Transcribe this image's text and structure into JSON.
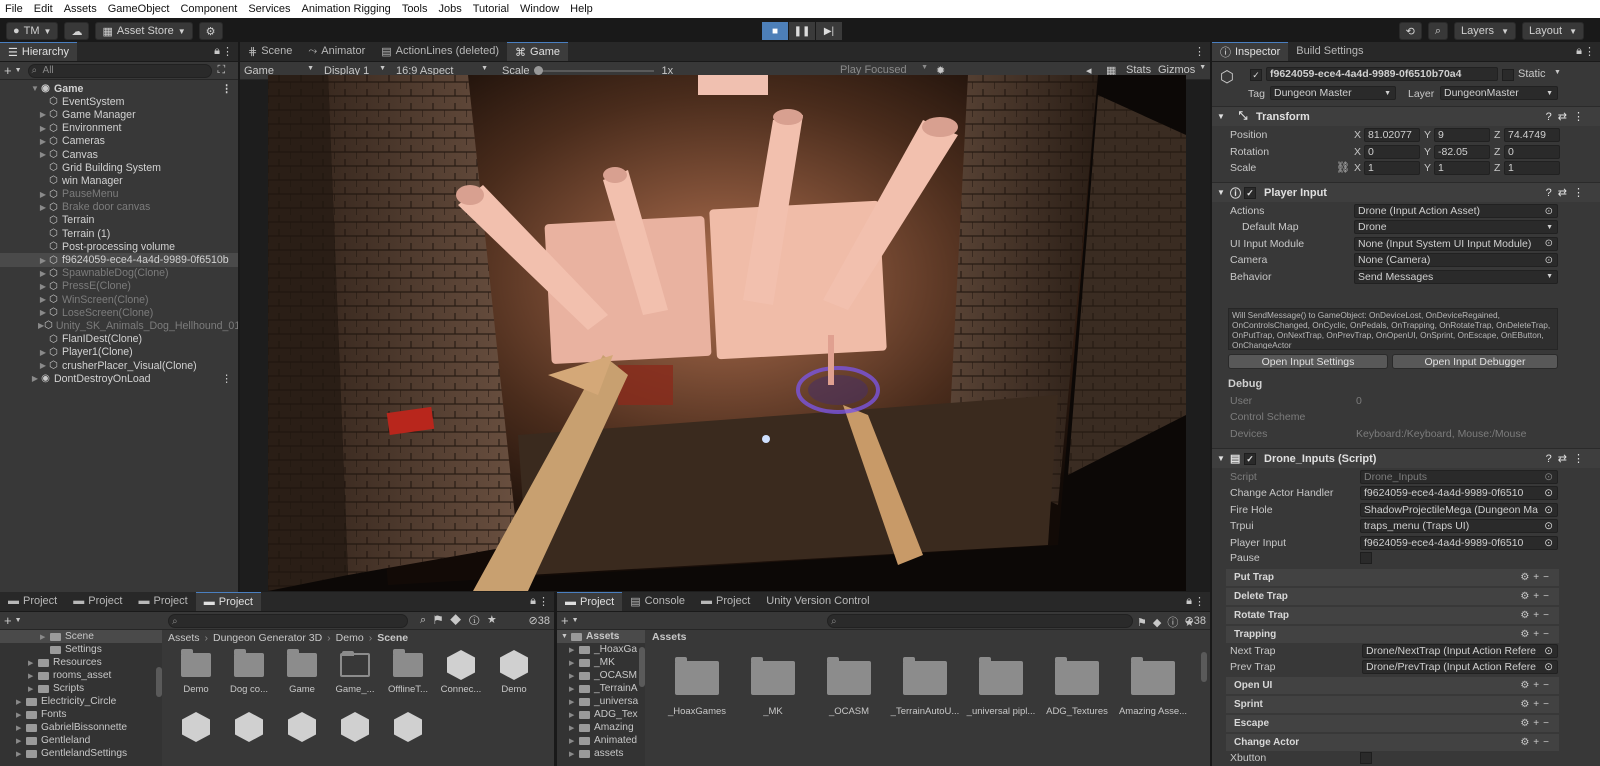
{
  "menu": [
    "File",
    "Edit",
    "Assets",
    "GameObject",
    "Component",
    "Services",
    "Animation Rigging",
    "Tools",
    "Jobs",
    "Tutorial",
    "Window",
    "Help"
  ],
  "toolbar": {
    "account": "TM",
    "asset_store": "Asset Store",
    "layers": "Layers",
    "layout": "Layout"
  },
  "hierarchy": {
    "tab": "Hierarchy",
    "search_placeholder": "All",
    "items": [
      {
        "label": "Game",
        "depth": 0,
        "dim": false,
        "arrow": "▼",
        "icon": "scene",
        "bold": true
      },
      {
        "label": "EventSystem",
        "depth": 1,
        "dim": false,
        "arrow": ""
      },
      {
        "label": "Game Manager",
        "depth": 1,
        "dim": false,
        "arrow": "▶"
      },
      {
        "label": "Environment",
        "depth": 1,
        "dim": false,
        "arrow": "▶"
      },
      {
        "label": "Cameras",
        "depth": 1,
        "dim": false,
        "arrow": "▶"
      },
      {
        "label": "Canvas",
        "depth": 1,
        "dim": false,
        "arrow": "▶"
      },
      {
        "label": "Grid Building System",
        "depth": 1,
        "dim": false,
        "arrow": ""
      },
      {
        "label": "win Manager",
        "depth": 1,
        "dim": false,
        "arrow": ""
      },
      {
        "label": "PauseMenu",
        "depth": 1,
        "dim": true,
        "arrow": "▶"
      },
      {
        "label": "Brake door canvas",
        "depth": 1,
        "dim": true,
        "arrow": "▶"
      },
      {
        "label": "Terrain",
        "depth": 1,
        "dim": false,
        "arrow": ""
      },
      {
        "label": "Terrain (1)",
        "depth": 1,
        "dim": false,
        "arrow": ""
      },
      {
        "label": "Post-processing volume",
        "depth": 1,
        "dim": false,
        "arrow": ""
      },
      {
        "label": "f9624059-ece4-4a4d-9989-0f6510b",
        "depth": 1,
        "dim": false,
        "arrow": "▶",
        "sel": true
      },
      {
        "label": "SpawnableDog(Clone)",
        "depth": 1,
        "dim": true,
        "arrow": "▶"
      },
      {
        "label": "PressE(Clone)",
        "depth": 1,
        "dim": true,
        "arrow": "▶"
      },
      {
        "label": "WinScreen(Clone)",
        "depth": 1,
        "dim": true,
        "arrow": "▶"
      },
      {
        "label": "LoseScreen(Clone)",
        "depth": 1,
        "dim": true,
        "arrow": "▶"
      },
      {
        "label": "Unity_SK_Animals_Dog_Hellhound_01",
        "depth": 1,
        "dim": true,
        "arrow": "▶"
      },
      {
        "label": "FlanIDest(Clone)",
        "depth": 1,
        "dim": false,
        "arrow": ""
      },
      {
        "label": "Player1(Clone)",
        "depth": 1,
        "dim": false,
        "arrow": "▶"
      },
      {
        "label": "crusherPlacer_Visual(Clone)",
        "depth": 1,
        "dim": false,
        "arrow": "▶"
      },
      {
        "label": "DontDestroyOnLoad",
        "depth": 0,
        "dim": false,
        "arrow": "▶",
        "icon": "scene"
      }
    ]
  },
  "center_tabs": {
    "scene": "Scene",
    "animator": "Animator",
    "actionlines": "ActionLines (deleted)",
    "game": "Game"
  },
  "game_bar": {
    "display_mode": "Game",
    "display": "Display 1",
    "aspect": "16:9 Aspect",
    "scale_label": "Scale",
    "scale_value": "1x",
    "play_focused": "Play Focused",
    "stats": "Stats",
    "gizmos": "Gizmos"
  },
  "inspector": {
    "tab": "Inspector",
    "tab2": "Build Settings",
    "object_name": "f9624059-ece4-4a4d-9989-0f6510b70a4",
    "static_label": "Static",
    "tag_label": "Tag",
    "tag_value": "Dungeon Master",
    "layer_label": "Layer",
    "layer_value": "DungeonMaster",
    "transform": {
      "title": "Transform",
      "position_label": "Position",
      "px": "81.02077",
      "py": "9",
      "pz": "74.4749",
      "rotation_label": "Rotation",
      "rx": "0",
      "ry": "-82.05",
      "rz": "0",
      "scale_label": "Scale",
      "sx": "1",
      "sy": "1",
      "sz": "1"
    },
    "player_input": {
      "title": "Player Input",
      "actions_label": "Actions",
      "actions_value": "Drone (Input Action Asset)",
      "default_map_label": "Default Map",
      "default_map_value": "Drone",
      "ui_label": "UI Input Module",
      "ui_value": "None (Input System UI Input Module)",
      "camera_label": "Camera",
      "camera_value": "None (Camera)",
      "behavior_label": "Behavior",
      "behavior_value": "Send Messages",
      "info": "Will SendMessage() to GameObject: OnDeviceLost, OnDeviceRegained, OnControlsChanged, OnCyclic, OnPedals, OnTrapping, OnRotateTrap, OnDeleteTrap, OnPutTrap, OnNextTrap, OnPrevTrap, OnOpenUI, OnSprint, OnEscape, OnEButton, OnChangeActor",
      "open_settings": "Open Input Settings",
      "open_debugger": "Open Input Debugger",
      "debug_label": "Debug",
      "user_label": "User",
      "user_value": "0",
      "scheme_label": "Control Scheme",
      "devices_label": "Devices",
      "devices_value": "Keyboard:/Keyboard, Mouse:/Mouse"
    },
    "drone": {
      "title": "Drone_Inputs (Script)",
      "script_label": "Script",
      "script_value": "Drone_Inputs",
      "handler_label": "Change Actor Handler",
      "handler_value": "f9624059-ece4-4a4d-9989-0f6510",
      "fire_label": "Fire Hole",
      "fire_value": "ShadowProjectileMega (Dungeon Ma",
      "trpui_label": "Trpui",
      "trpui_value": "traps_menu (Traps UI)",
      "pinput_label": "Player Input",
      "pinput_value": "f9624059-ece4-4a4d-9989-0f6510",
      "pause_label": "Pause",
      "put_trap": "Put Trap",
      "delete_trap": "Delete Trap",
      "rotate_trap": "Rotate Trap",
      "trapping": "Trapping",
      "next_label": "Next Trap",
      "next_value": "Drone/NextTrap (Input Action Refere",
      "prev_label": "Prev Trap",
      "prev_value": "Drone/PrevTrap (Input Action Refere",
      "open_ui": "Open UI",
      "sprint": "Sprint",
      "escape": "Escape",
      "change_actor": "Change Actor",
      "xbutton_label": "Xbutton"
    }
  },
  "project_left": {
    "tabs": [
      "Project",
      "Project",
      "Project",
      "Project"
    ],
    "breadcrumb": [
      "Assets",
      "Dungeon Generator 3D",
      "Demo",
      "Scene"
    ],
    "count": "38",
    "tree": [
      {
        "label": "Scene",
        "indent": 2,
        "sel": true
      },
      {
        "label": "Settings",
        "indent": 2
      },
      {
        "label": "Resources",
        "indent": 1
      },
      {
        "label": "rooms_asset",
        "indent": 1
      },
      {
        "label": "Scripts",
        "indent": 1
      },
      {
        "label": "Electricity_Circle",
        "indent": 0
      },
      {
        "label": "Fonts",
        "indent": 0
      },
      {
        "label": "GabrielBissonnette",
        "indent": 0
      },
      {
        "label": "Gentleland",
        "indent": 0
      },
      {
        "label": "GentlelandSettings",
        "indent": 0
      }
    ],
    "assets": [
      {
        "label": "Demo",
        "type": "folder"
      },
      {
        "label": "Dog co...",
        "type": "folder"
      },
      {
        "label": "Game",
        "type": "folder"
      },
      {
        "label": "Game_...",
        "type": "folder-open"
      },
      {
        "label": "OfflineT...",
        "type": "folder"
      },
      {
        "label": "Connec...",
        "type": "unity"
      },
      {
        "label": "Demo",
        "type": "unity"
      }
    ]
  },
  "project_right": {
    "tabs": [
      "Project",
      "Console",
      "Project",
      "Unity Version Control"
    ],
    "root": "Assets",
    "header": "Assets",
    "count": "38",
    "tree": [
      "_HoaxGa",
      "_MK",
      "_OCASM",
      "_TerrainA",
      "_universa",
      "ADG_Tex",
      "Amazing",
      "Animated",
      "assets"
    ],
    "assets": [
      "_HoaxGames",
      "_MK",
      "_OCASM",
      "_TerrainAutoU...",
      "_universal pipl...",
      "ADG_Textures",
      "Amazing Asse..."
    ]
  }
}
